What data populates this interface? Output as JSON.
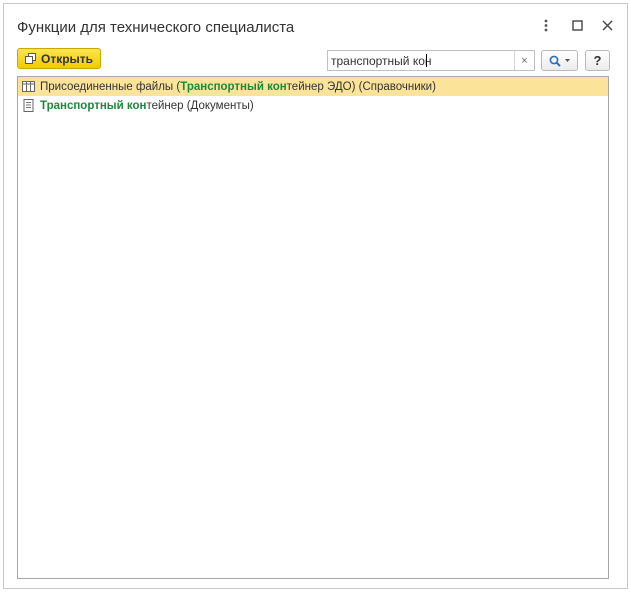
{
  "window": {
    "title": "Функции для технического специалиста"
  },
  "toolbar": {
    "open_label": "Открыть",
    "search_value": "транспортный кон",
    "clear_label": "×",
    "help_label": "?"
  },
  "results": [
    {
      "selected": true,
      "icon": "catalog-table-icon",
      "prefix": "Присоединенные файлы (",
      "match": "Транспортный кон",
      "suffix": "тейнер ЭДО) (Справочники)"
    },
    {
      "selected": false,
      "icon": "document-icon",
      "prefix": "",
      "match": "Транспортный кон",
      "suffix": "тейнер (Документы)"
    }
  ],
  "colors": {
    "accent_yellow": "#f2cc00",
    "selection": "#fbe39a",
    "match_green": "#1a8a3a",
    "search_icon_blue": "#2a6ebd"
  }
}
